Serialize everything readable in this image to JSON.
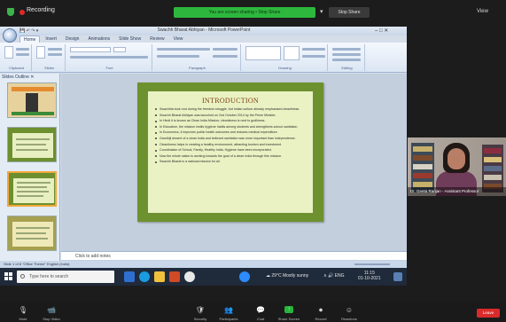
{
  "meeting": {
    "recording_label": "Recording",
    "share_banner": "You are screen sharing  •  Stop Share",
    "stop_share_label": "Stop Share",
    "view_label": "View",
    "participant_name": "Dr. Geeta Ranjan - Assistant Professor",
    "toolbar": [
      {
        "name": "mute",
        "icon": "🎙",
        "label": "Mute"
      },
      {
        "name": "video",
        "icon": "📹",
        "label": "Stop Video"
      },
      {
        "name": "security",
        "icon": "🛡",
        "label": "Security"
      },
      {
        "name": "participants",
        "icon": "👥",
        "label": "Participants"
      },
      {
        "name": "chat",
        "icon": "💬",
        "label": "Chat"
      },
      {
        "name": "share",
        "icon": "↑",
        "label": "Share Screen"
      },
      {
        "name": "record",
        "icon": "⏺",
        "label": "Record"
      },
      {
        "name": "reactions",
        "icon": "☺",
        "label": "Reactions"
      }
    ],
    "leave_label": "Leave"
  },
  "powerpoint": {
    "window_title": "Swachh Bharat Abhiyan - Microsoft PowerPoint",
    "window_controls": "–   □   ✕",
    "quick_access": "💾 ↶ ↷ ▾",
    "tabs": [
      "Home",
      "Insert",
      "Design",
      "Animations",
      "Slide Show",
      "Review",
      "View"
    ],
    "groups": [
      "Clipboard",
      "Slides",
      "Font",
      "Paragraph",
      "Drawing",
      "Editing"
    ],
    "pane_tabs": "Slides   Outline   ✕",
    "slide": {
      "title": "INTRODUCTION",
      "bullets": [
        "Swachhta took root during the freedom struggle, but Indian culture already emphasised cleanliness.",
        "Swachh Bharat Abhiyan was launched on 2nd October 2014 by the Prime Minister.",
        "In Hindi it is known as Clean India Mission; cleanliness is next to godliness.",
        "In Education, the mission instils hygiene habits among students and strengthens school sanitation.",
        "In Economics, it improves public health outcomes and reduces medical expenditure.",
        "Gandhiji dreamt of a clean India and believed sanitation was more important than independence.",
        "Cleanliness helps in creating a healthy environment, attracting tourism and investment.",
        "Coordination of School, Family, Healthy India, Hygiene have been incorporated.",
        "Now the whole nation is working towards the goal of a clean India through this mission.",
        "Swachh Bharat is a national mission for all."
      ]
    },
    "notes_placeholder": "Click to add notes",
    "status_text": "Slide 1 of 8    \"Office Theme\"    English (India)",
    "taskbar": {
      "search_placeholder": "Type here to search",
      "weather": "☁ 29°C  Mostly sunny",
      "tray": "∧  🔊  ENG",
      "time": "11:15",
      "date": "01-10-2021"
    }
  },
  "colors": {
    "accent_green": "#27b43c",
    "slide_green": "#6e9130",
    "slide_title": "#7a3d0d",
    "leave_red": "#d82b2b"
  }
}
